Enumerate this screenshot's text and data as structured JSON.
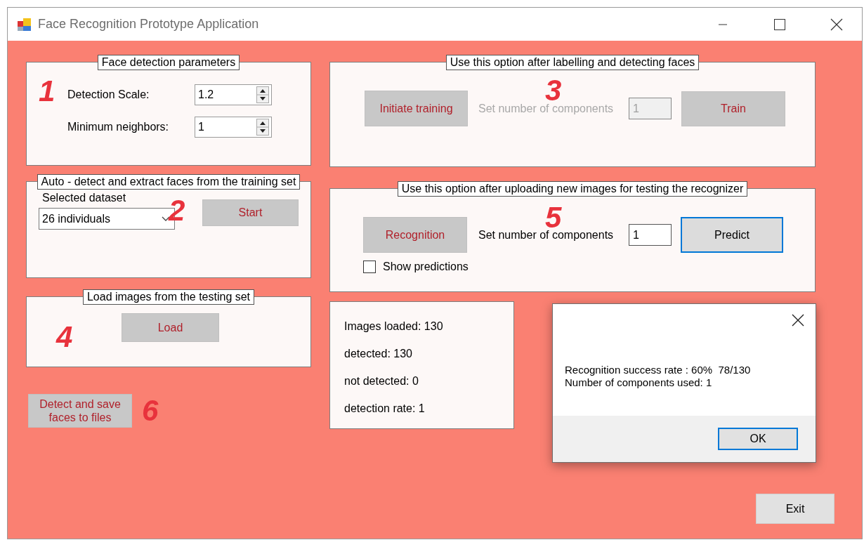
{
  "window": {
    "title": "Face Recognition Prototype Application"
  },
  "detection_parameters": {
    "legend": "Face detection parameters",
    "step": "1",
    "fields": [
      {
        "label": "Detection Scale:",
        "value": "1.2"
      },
      {
        "label": "Minimum neighbors:",
        "value": "1"
      }
    ]
  },
  "auto_detect": {
    "legend": "Auto - detect and extract faces from the training set",
    "step": "2",
    "dataset_label": "Selected dataset",
    "dataset": "26 individuals",
    "button": {
      "label": "Start",
      "kind": "action",
      "focused": false
    }
  },
  "load_images": {
    "legend": "Load images from the testing set",
    "step": "4",
    "button": {
      "label": "Load",
      "kind": "action",
      "focused": false
    }
  },
  "detect_save": {
    "button": {
      "label": "Detect and save faces to files",
      "kind": "action",
      "focused": false
    },
    "step": "6"
  },
  "training": {
    "legend": "Use this option after labelling and detecting faces",
    "step": "3",
    "initiate_button": {
      "label": "Initiate training",
      "kind": "action",
      "focused": false
    },
    "components_label": "Set number of components",
    "components_value": "1",
    "disabled": true,
    "train_button": {
      "label": "Train",
      "kind": "action",
      "focused": false
    }
  },
  "testing": {
    "legend": "Use this option after uploading new images for testing the recognizer",
    "step": "5",
    "recognition_button": {
      "label": "Recognition",
      "kind": "action",
      "focused": false
    },
    "components_label": "Set number of components",
    "components_value": "1",
    "disabled": false,
    "predict_button": {
      "label": "Predict",
      "kind": "default",
      "focused": true
    },
    "show_predictions": {
      "label": "Show predictions",
      "checked": false
    }
  },
  "stats": [
    "Images loaded: 130",
    "detected: 130",
    "not detected: 0",
    "detection rate: 1"
  ],
  "dialog": {
    "message_lines": [
      "Recognition success rate : 60%  78/130",
      "Number of components used: 1"
    ],
    "ok_button": {
      "label": "OK",
      "kind": "default",
      "focused": true
    }
  },
  "exit_button": {
    "label": "Exit",
    "kind": "default",
    "focused": false
  }
}
